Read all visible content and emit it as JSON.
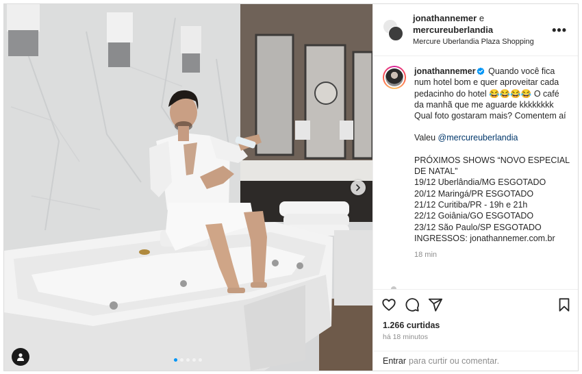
{
  "post": {
    "header": {
      "user1": "jonathannemer",
      "connector": "e",
      "user2": "mercureuberlandia",
      "location": "Mercure Uberlandia Plaza Shopping",
      "more_label": "•••"
    },
    "caption": {
      "username": "jonathannemer",
      "text_intro": "Quando você fica num hotel bom e quer aproveitar cada pedacinho do hotel 😂😂😂😂 O café da manhã que me aguarde kkkkkkkk Qual foto gostaram mais? Comentem aí",
      "thanks_prefix": "Valeu",
      "thanks_mention": "@mercureuberlandia",
      "shows_title": "PRÓXIMOS SHOWS “NOVO ESPECIAL DE NATAL”",
      "shows": [
        "19/12 Uberlândia/MG ESGOTADO",
        "20/12 Maringá/PR ESGOTADO",
        "21/12 Curitiba/PR - 19h e 21h",
        "22/12 Goiânia/GO ESGOTADO",
        "23/12 São Paulo/SP ESGOTADO"
      ],
      "tickets": "INGRESSOS: jonathannemer.com.br",
      "time": "18 min"
    },
    "likes": "1.266 curtidas",
    "posted_ago": "há 18 minutos",
    "login_prompt": {
      "link": "Entrar",
      "rest": "para curtir ou comentar."
    },
    "carousel": {
      "count": 5,
      "active_index": 0
    },
    "icons": {
      "like": "heart-icon",
      "comment": "comment-icon",
      "share": "share-icon",
      "save": "bookmark-icon",
      "next": "chevron-right-icon",
      "tag": "user-tag-icon",
      "verified": "verified-badge-icon"
    },
    "colors": {
      "verified": "#0095f6",
      "mention": "#00376b",
      "muted": "#8e8e8e"
    }
  }
}
